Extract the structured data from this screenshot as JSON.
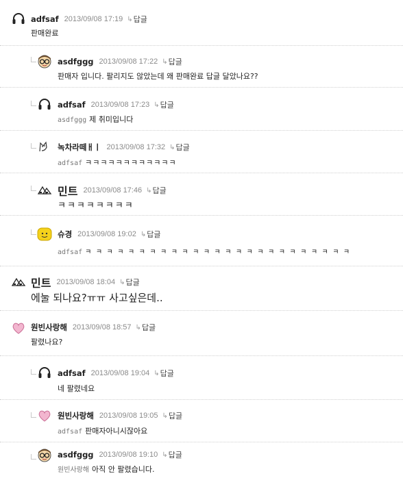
{
  "reply_label": "답글",
  "comments": [
    {
      "author": "adfsaf",
      "date": "2013/09/08 17:19",
      "text": "판매완료",
      "mention": "",
      "icon": "headphones-icon"
    },
    {
      "author": "asdfggg",
      "date": "2013/09/08 17:22",
      "text": "판매자 입니다. 팔리지도 않았는데 왜 판매완료 답글 달았나요??",
      "mention": "",
      "icon": "glasses-face-icon"
    },
    {
      "author": "adfsaf",
      "date": "2013/09/08 17:23",
      "text": "제 취미입니다",
      "mention": "asdfggg",
      "icon": "headphones-icon"
    },
    {
      "author": "녹차라떼ㅐㅣ",
      "date": "2013/09/08 17:32",
      "text": "ㅋㅋㅋㅋㅋㅋㅋㅋㅋㅋㅋㅋ",
      "mention": "adfsaf",
      "icon": "cat-doodle-icon"
    },
    {
      "author": "민트",
      "date": "2013/09/08 17:46",
      "text": "ㅋㅋㅋㅋㅋㅋㅋㅋ",
      "mention": "",
      "icon": "mint-avatar-icon"
    },
    {
      "author": "슈경",
      "date": "2013/09/08 19:02",
      "text": "ㅋㅋㅋㅋㅋㅋㅋㅋㅋㅋㅋㅋㅋㅋㅋㅋㅋㅋㅋㅋㅋㅋㅋㅋㅋ",
      "mention": "adfsaf",
      "icon": "yellow-smiley-icon"
    },
    {
      "author": "민트",
      "date": "2013/09/08 18:04",
      "text": "에눌 되나요?ㅠㅠ 사고싶은데..",
      "mention": "",
      "icon": "mint-avatar-icon"
    },
    {
      "author": "원빈사랑해",
      "date": "2013/09/08 18:57",
      "text": "팔렸나요?",
      "mention": "",
      "icon": "heart-icon"
    },
    {
      "author": "adfsaf",
      "date": "2013/09/08 19:04",
      "text": "네 팔렸네요",
      "mention": "",
      "icon": "headphones-icon"
    },
    {
      "author": "원빈사랑해",
      "date": "2013/09/08 19:05",
      "text": "판매자아니시잖아요",
      "mention": "adfsaf",
      "icon": "heart-icon"
    },
    {
      "author": "asdfggg",
      "date": "2013/09/08 19:10",
      "text": "아직 안 팔렸습니다.",
      "mention": "원빈사랑해",
      "icon": "glasses-face-icon"
    }
  ]
}
